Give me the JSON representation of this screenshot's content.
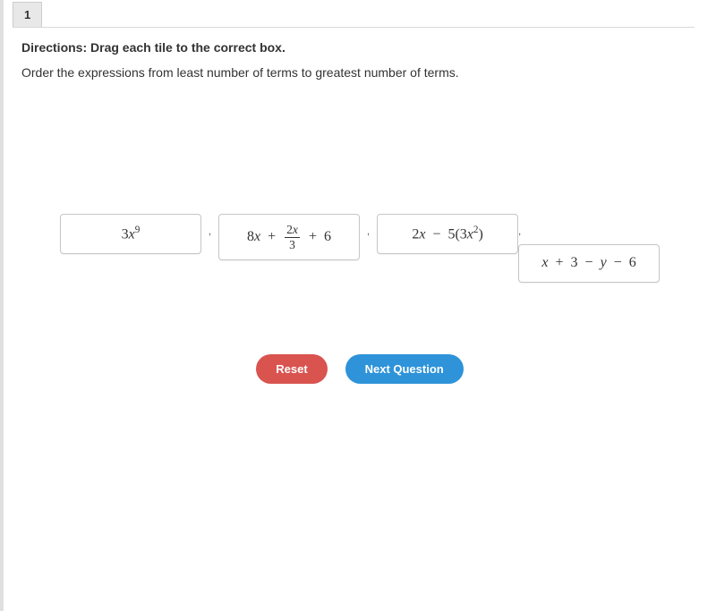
{
  "question_number": "1",
  "directions_label": "Directions: Drag each tile to the correct box.",
  "prompt": "Order the expressions from least number of terms to greatest number of terms.",
  "separator": ",",
  "tiles": [
    {
      "expr_plain": "3x^9"
    },
    {
      "expr_plain": "8x + 2x/3 + 6"
    },
    {
      "expr_plain": "2x − 5(3x^2)"
    },
    {
      "expr_plain": "x + 3 − y − 6"
    }
  ],
  "buttons": {
    "reset": "Reset",
    "next": "Next Question"
  }
}
